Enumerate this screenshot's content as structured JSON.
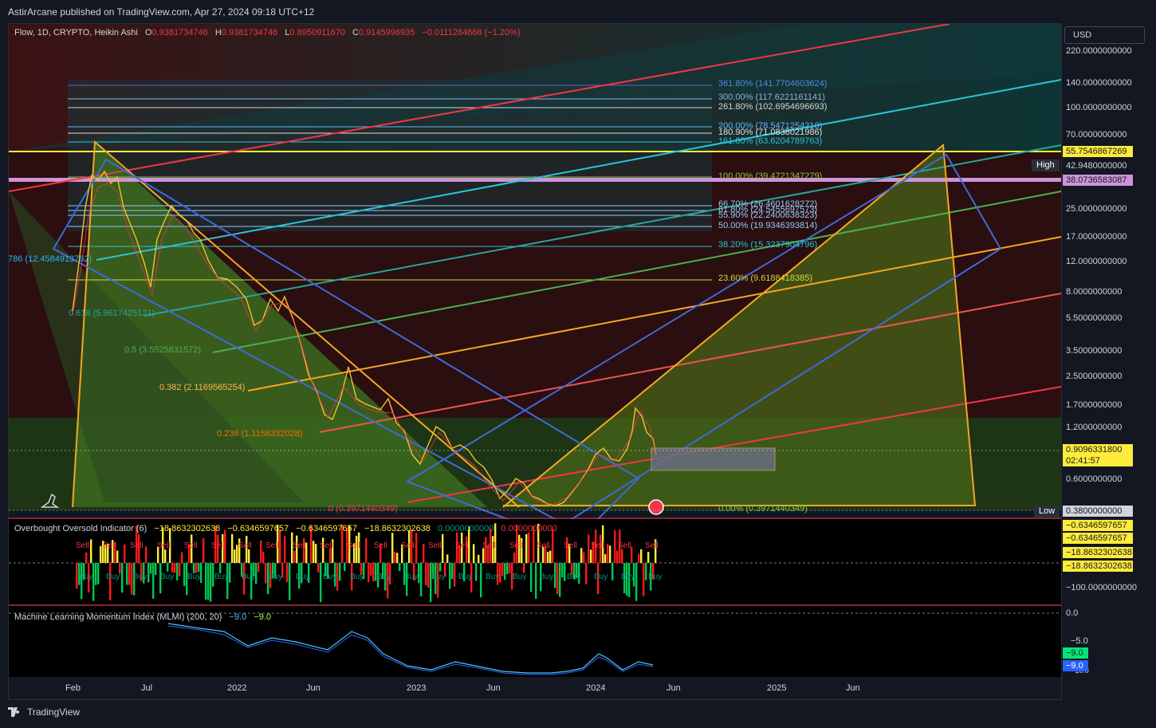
{
  "header": {
    "publisher": "AstirArcane published on TradingView.com, Apr 27, 2024 09:18 UTC+12"
  },
  "legend": {
    "symbol": "Flow, 1D, CRYPTO, Heikin Ashi",
    "o_label": "O",
    "o_value": "0.9381734746",
    "h_label": "H",
    "h_value": "0.9381734746",
    "l_label": "L",
    "l_value": "0.8950911670",
    "c_label": "C",
    "c_value": "0.9145996935",
    "change": "−0.0111284668 (−1.20%)"
  },
  "price_axis": {
    "currency": "USD",
    "ticks": [
      "220.0000000000",
      "140.0000000000",
      "100.0000000000",
      "70.0000000000",
      "42.9480000000",
      "25.0000000000",
      "17.0000000000",
      "12.0000000000",
      "8.0000000000",
      "5.5000000000",
      "3.5000000000",
      "2.5000000000",
      "1.7000000000",
      "1.2000000000",
      "0.6000000000",
      "0.3800000000"
    ],
    "tag_upper": "55.7546867269",
    "tag_lower": "38.0736583087",
    "high_label": "High",
    "low_label": "Low",
    "current_price": "0.9096331800",
    "countdown": "02:41:57"
  },
  "time_axis": {
    "labels": [
      "Feb",
      "Jul",
      "2022",
      "Jun",
      "2023",
      "Jun",
      "2024",
      "Jun",
      "2025",
      "Jun"
    ]
  },
  "fib_right": [
    {
      "text": "361.80% (141.7704603624)",
      "color": "#4c8ee6"
    },
    {
      "text": "300.00% (117.6221161141)",
      "color": "#8ab4e8"
    },
    {
      "text": "261.80% (102.6954696693)",
      "color": "#d1d4dc"
    },
    {
      "text": "200.00% (78.5471254210)",
      "color": "#64b5f6"
    },
    {
      "text": "180.90% (71.0838021986)",
      "color": "#e0e0e0"
    },
    {
      "text": "161.80% (63.6204789763)",
      "color": "#26c6da"
    },
    {
      "text": "100.00% (39.4721347279)",
      "color": "#8bc34a"
    },
    {
      "text": "66.70% (26.4601628272)",
      "color": "#90caf9"
    },
    {
      "text": "61.80% (24.5455697573)",
      "color": "#90caf9"
    },
    {
      "text": "55.90% (22.2400638323)",
      "color": "#90caf9"
    },
    {
      "text": "50.00% (19.9346393814)",
      "color": "#90caf9"
    },
    {
      "text": "38.20% (15.3237904796)",
      "color": "#26c6da"
    },
    {
      "text": "23.60% (9.6188418385)",
      "color": "#cddc39"
    },
    {
      "text": "0.00% (0.3971440349)",
      "color": "#8bc34a"
    }
  ],
  "fib_left": [
    {
      "text": "786 (12.4584913762)",
      "color": "#29b6f6"
    },
    {
      "text": "0.618 (5.9617425121)",
      "color": "#26a69a"
    },
    {
      "text": "0.5 (3.5525831572)",
      "color": "#4caf50"
    },
    {
      "text": "0.382 (2.1169565254)",
      "color": "#ffb74d"
    },
    {
      "text": "0.236 (1.1156332028)",
      "color": "#ef6c00"
    },
    {
      "text": "0 (0.3971440349)",
      "color": "#f23645"
    }
  ],
  "oboi": {
    "title": "Overbought Oversold Indicator (6)",
    "values": [
      "−18.8632302638",
      "−0.6346597657",
      "−0.6346597657",
      "−18.8632302638",
      "0.0000000000",
      "0.0000000000"
    ],
    "axis_tick": "−100.0000000000",
    "tags": [
      "−0.6346597657",
      "−0.6346597657",
      "−18.8632302638",
      "−18.8632302638"
    ],
    "sell_text": "Sell",
    "buy_text": "Buy"
  },
  "mlmi": {
    "title": "Machine Learning Momentum Index (MLMI) (200, 20)",
    "values": [
      "−9.0",
      "−9.0"
    ],
    "axis_ticks": [
      "0.0",
      "−5.0",
      "−10.0"
    ],
    "tags": [
      "−9.0",
      "−9.0"
    ]
  },
  "footer": {
    "brand": "TradingView"
  },
  "colors": {
    "bg": "#131722",
    "red": "#f23645",
    "green": "#089981",
    "yellow": "#ffeb3b",
    "orange": "#f5a623",
    "blue": "#2962ff",
    "cyan": "#26c6da",
    "pink": "#ce93d8"
  }
}
